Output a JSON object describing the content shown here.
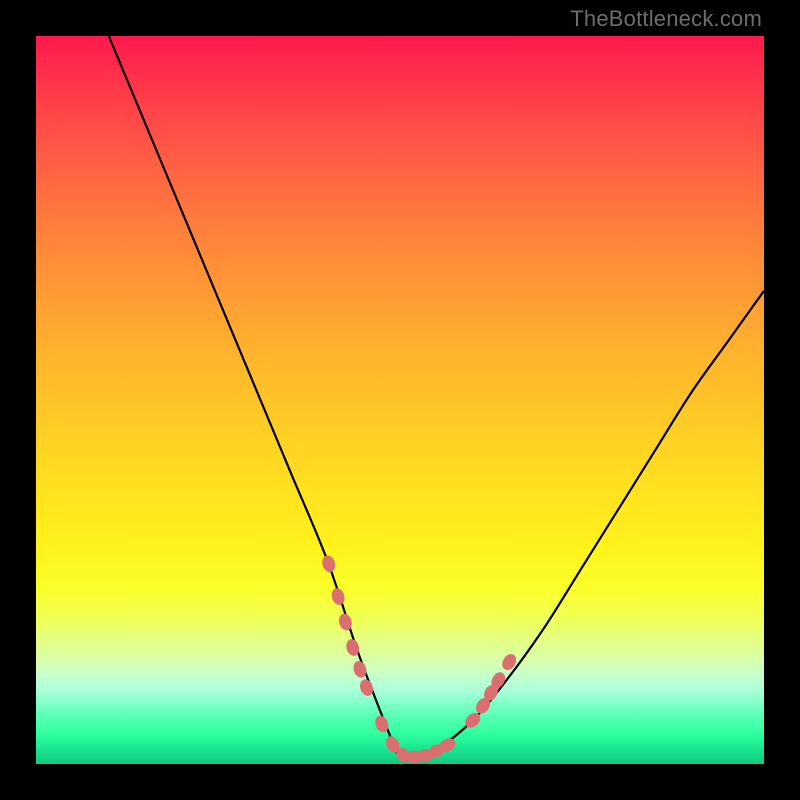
{
  "watermark": "TheBottleneck.com",
  "colors": {
    "frame_bg_top": "#ff1a4d",
    "frame_bg_bottom": "#14c97e",
    "curve": "#000000",
    "marker": "#db6e6e",
    "page_bg": "#000000",
    "watermark_color": "#6d6d6d"
  },
  "chart_data": {
    "type": "line",
    "title": "",
    "xlabel": "",
    "ylabel": "",
    "xlim": [
      0,
      100
    ],
    "ylim": [
      0,
      100
    ],
    "grid": false,
    "legend": false,
    "series": [
      {
        "name": "bottleneck-curve",
        "x": [
          10,
          15,
          20,
          25,
          30,
          35,
          40,
          44,
          47,
          49,
          50,
          52,
          55,
          60,
          65,
          70,
          75,
          80,
          85,
          90,
          95,
          100
        ],
        "y": [
          100,
          88,
          76,
          64,
          52,
          40,
          28,
          16,
          8,
          3,
          1,
          1,
          2,
          6,
          12,
          19,
          27,
          35,
          43,
          51,
          58,
          65
        ]
      }
    ],
    "markers": {
      "name": "highlight-points",
      "x": [
        40.2,
        41.5,
        42.5,
        43.5,
        44.5,
        45.4,
        47.5,
        49.0,
        50.5,
        52.0,
        53.5,
        55.0,
        56.5,
        60.0,
        61.4,
        62.5,
        63.5,
        65.0
      ],
      "y": [
        27.5,
        23.0,
        19.5,
        16.0,
        13.0,
        10.5,
        5.5,
        2.7,
        1.2,
        1.0,
        1.2,
        1.8,
        2.6,
        6.0,
        8.0,
        9.8,
        11.5,
        14.0
      ]
    }
  }
}
